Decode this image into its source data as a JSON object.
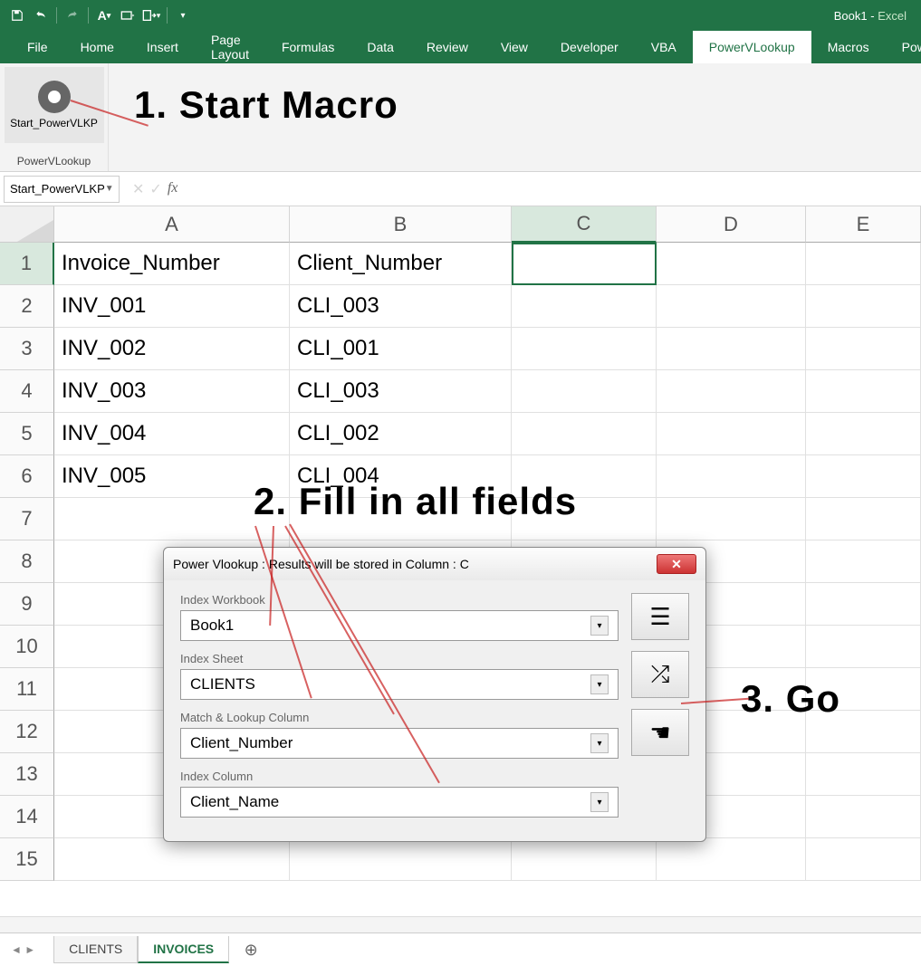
{
  "app_title": {
    "book": "Book1",
    "sep": "  -  ",
    "app": "Excel"
  },
  "qat_items": [
    "save",
    "undo",
    "redo",
    "font-size",
    "touch-mode",
    "export",
    "more"
  ],
  "ribbon_tabs": [
    "File",
    "Home",
    "Insert",
    "Page Layout",
    "Formulas",
    "Data",
    "Review",
    "View",
    "Developer",
    "VBA",
    "PowerVLookup",
    "Macros",
    "Power"
  ],
  "active_ribbon_tab": "PowerVLookup",
  "ribbon": {
    "macro_button": "Start_PowerVLKP",
    "group_label": "PowerVLookup"
  },
  "name_box": "Start_PowerVLKP",
  "formula": "",
  "columns": [
    "A",
    "B",
    "C",
    "D",
    "E"
  ],
  "selected_cell": "C1",
  "rows": [
    {
      "n": 1,
      "cells": [
        "Invoice_Number",
        "Client_Number",
        "",
        "",
        ""
      ]
    },
    {
      "n": 2,
      "cells": [
        "INV_001",
        "CLI_003",
        "",
        "",
        ""
      ]
    },
    {
      "n": 3,
      "cells": [
        "INV_002",
        "CLI_001",
        "",
        "",
        ""
      ]
    },
    {
      "n": 4,
      "cells": [
        "INV_003",
        "CLI_003",
        "",
        "",
        ""
      ]
    },
    {
      "n": 5,
      "cells": [
        "INV_004",
        "CLI_002",
        "",
        "",
        ""
      ]
    },
    {
      "n": 6,
      "cells": [
        "INV_005",
        "CLI_004",
        "",
        "",
        ""
      ]
    },
    {
      "n": 7,
      "cells": [
        "",
        "",
        "",
        "",
        ""
      ]
    },
    {
      "n": 8,
      "cells": [
        "",
        "",
        "",
        "",
        ""
      ]
    },
    {
      "n": 9,
      "cells": [
        "",
        "",
        "",
        "",
        ""
      ]
    },
    {
      "n": 10,
      "cells": [
        "",
        "",
        "",
        "",
        ""
      ]
    },
    {
      "n": 11,
      "cells": [
        "",
        "",
        "",
        "",
        ""
      ]
    },
    {
      "n": 12,
      "cells": [
        "",
        "",
        "",
        "",
        ""
      ]
    },
    {
      "n": 13,
      "cells": [
        "",
        "",
        "",
        "",
        ""
      ]
    },
    {
      "n": 14,
      "cells": [
        "",
        "",
        "",
        "",
        ""
      ]
    },
    {
      "n": 15,
      "cells": [
        "",
        "",
        "",
        "",
        ""
      ]
    }
  ],
  "sheet_tabs": [
    "CLIENTS",
    "INVOICES"
  ],
  "active_sheet": "INVOICES",
  "dialog": {
    "title": "Power Vlookup : Results will be stored in Column : C",
    "labels": {
      "index_workbook": "Index Workbook",
      "index_sheet": "Index Sheet",
      "match_lookup": "Match & Lookup Column",
      "index_column": "Index Column"
    },
    "values": {
      "index_workbook": "Book1",
      "index_sheet": "CLIENTS",
      "match_lookup": "Client_Number",
      "index_column": "Client_Name"
    },
    "side_icons": [
      "menu",
      "shuffle",
      "pointer"
    ]
  },
  "annotations": {
    "a1": "1. Start Macro",
    "a2": "2. Fill in all fields",
    "a3": "3. Go"
  }
}
